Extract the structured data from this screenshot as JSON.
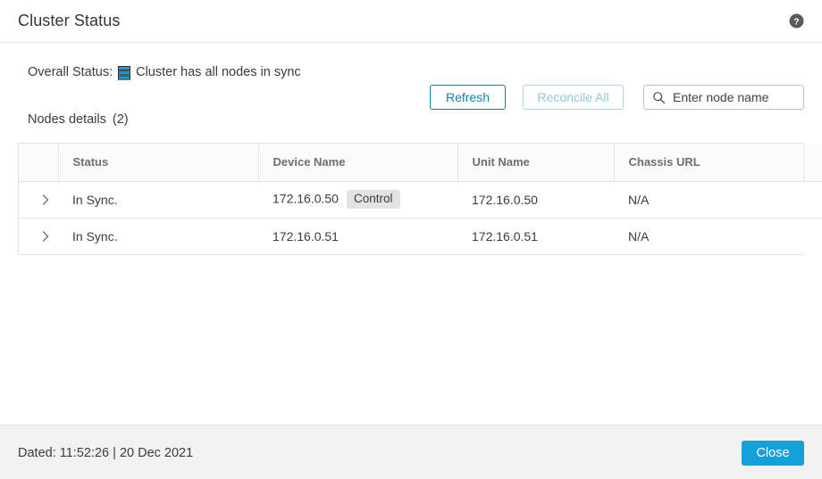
{
  "dialog": {
    "title": "Cluster Status",
    "help_icon": "help-circle-icon"
  },
  "overall": {
    "label": "Overall Status:",
    "icon": "cluster-stack-icon",
    "text": "Cluster has all nodes in sync"
  },
  "toolbar": {
    "nodes_details_label": "Nodes details",
    "nodes_count": "(2)",
    "refresh_label": "Refresh",
    "reconcile_label": "Reconcile All",
    "search_placeholder": "Enter node name",
    "search_value": "",
    "search_icon": "search-icon"
  },
  "table": {
    "columns": [
      {
        "key": "expand",
        "label": ""
      },
      {
        "key": "status",
        "label": "Status"
      },
      {
        "key": "device_name",
        "label": "Device Name"
      },
      {
        "key": "unit_name",
        "label": "Unit Name"
      },
      {
        "key": "chassis_url",
        "label": "Chassis URL"
      },
      {
        "key": "actions",
        "label": ""
      }
    ],
    "rows": [
      {
        "status": "In Sync.",
        "device_name": "172.16.0.50",
        "device_badge": "Control",
        "unit_name": "172.16.0.50",
        "chassis_url": "N/A"
      },
      {
        "status": "In Sync.",
        "device_name": "172.16.0.51",
        "device_badge": "",
        "unit_name": "172.16.0.51",
        "chassis_url": "N/A"
      }
    ]
  },
  "footer": {
    "date_text": "Dated: 11:52:26 | 20 Dec 2021",
    "close_label": "Close"
  },
  "colors": {
    "accent_blue": "#12a1d9",
    "link_teal": "#1184a8",
    "disabled_blue": "#8fc7dc",
    "cluster_icon": "#1ba0d7",
    "badge_bg": "#e3e3e3",
    "footer_bg": "#f2f2f2"
  }
}
